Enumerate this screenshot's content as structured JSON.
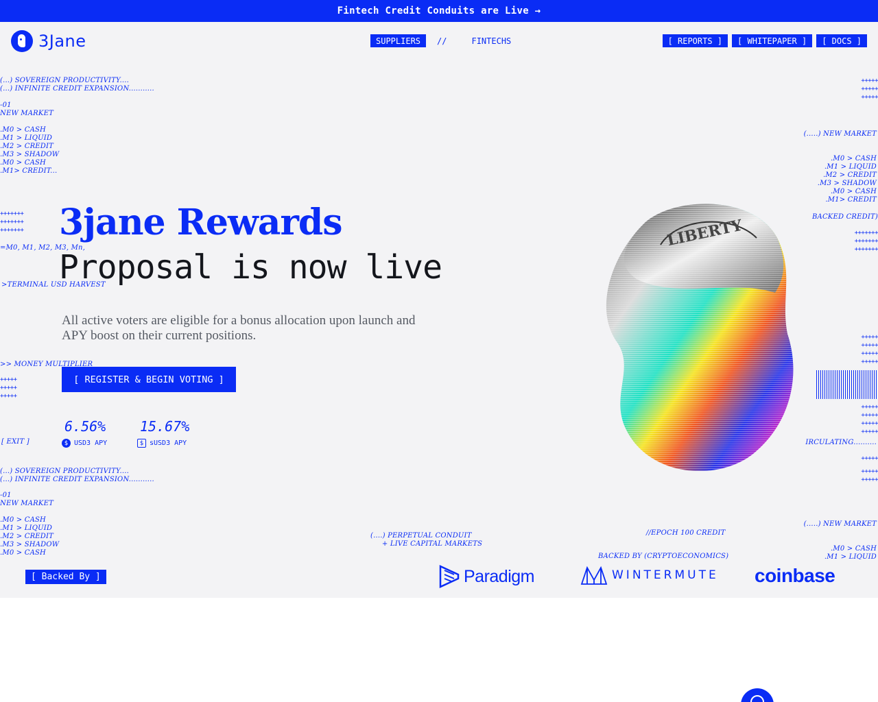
{
  "banner": {
    "text": "Fintech Credit Conduits are Live →"
  },
  "header": {
    "brand": "3Jane",
    "nav": {
      "suppliers": "SUPPLIERS",
      "separator": "//",
      "fintechs": "FINTECHS"
    },
    "right_links": [
      "[ REPORTS ]",
      "[ WHITEPAPER ]",
      "[ DOCS ]"
    ]
  },
  "deco_left": {
    "block1": "(...) SOVEREIGN PRODUCTIVITY....\n(...) INFINITE CREDIT EXPANSION...........",
    "block2": "-01\nNEW MARKET",
    "block3": ".M0 > CASH\n.M1 > LIQUID\n.M2 > CREDIT\n.M3 > SHADOW\n.M0 > CASH\n.M1> CREDIT...",
    "plus1": "+++++++\n+++++++\n+++++++",
    "formula": "=M0, M1, M2, M3, Mn,",
    "terminal": ">TERMINAL USD HARVEST",
    "money": ">> MONEY MULTIPLIER",
    "plus2": "+++++\n+++++\n+++++",
    "exit": "[ EXIT ]",
    "block4": "(...) SOVEREIGN PRODUCTIVITY....\n(...) INFINITE CREDIT EXPANSION...........",
    "block5": "-01\nNEW MARKET",
    "block6": ".M0 > CASH\n.M1 > LIQUID\n.M2 > CREDIT\n.M3 > SHADOW\n.M0 > CASH"
  },
  "deco_right": {
    "plus1": "+++++\n+++++\n+++++",
    "new_market": "(.....) NEW MARKET",
    "block": ".M0 > CASH\n.M1 > LIQUID\n.M2 > CREDIT\n.M3 > SHADOW\n.M0 > CASH\n.M1> CREDIT",
    "backed_credit": "BACKED CREDIT)",
    "plus2": "+++++++\n+++++++\n+++++++",
    "plus3": "+++++\n+++++\n+++++\n+++++",
    "plus4": "+++++\n+++++\n+++++\n+++++",
    "circulating": "IRCULATING..........",
    "plus5": "+++++",
    "plus6": "+++++\n+++++",
    "new_market2": "(.....) NEW MARKET",
    "block2": ".M0 > CASH\n.M1 > LIQUID"
  },
  "deco_bottom": {
    "conduit": "(....) PERPETUAL CONDUIT\n     + LIVE CAPITAL MARKETS",
    "epoch": "//EPOCH 100 CREDIT",
    "backed_by_crypto": "BACKED BY (CRYPTOECONOMICS)"
  },
  "hero": {
    "title": "3jane Rewards",
    "subtitle": "Proposal is now live",
    "description": "All active voters are eligible for a bonus allocation upon launch and APY boost on their current positions.",
    "cta": "[ REGISTER & BEGIN VOTING ]"
  },
  "stats": [
    {
      "value": "6.56%",
      "label": "USD3 APY",
      "icon": "usd3-coin-icon"
    },
    {
      "value": "15.67%",
      "label": "sUSD3 APY",
      "icon": "susd3-coin-icon"
    }
  ],
  "backers": {
    "tag": "[ Backed By ]",
    "paradigm": "Paradigm",
    "wintermute": "WINTERMUTE",
    "coinbase": "coinbase"
  },
  "coin_art": {
    "text": "LIBERTY"
  },
  "colors": {
    "accent": "#0a2cf5",
    "hero_bg": "#f3f3f5",
    "ink": "#14161c"
  }
}
